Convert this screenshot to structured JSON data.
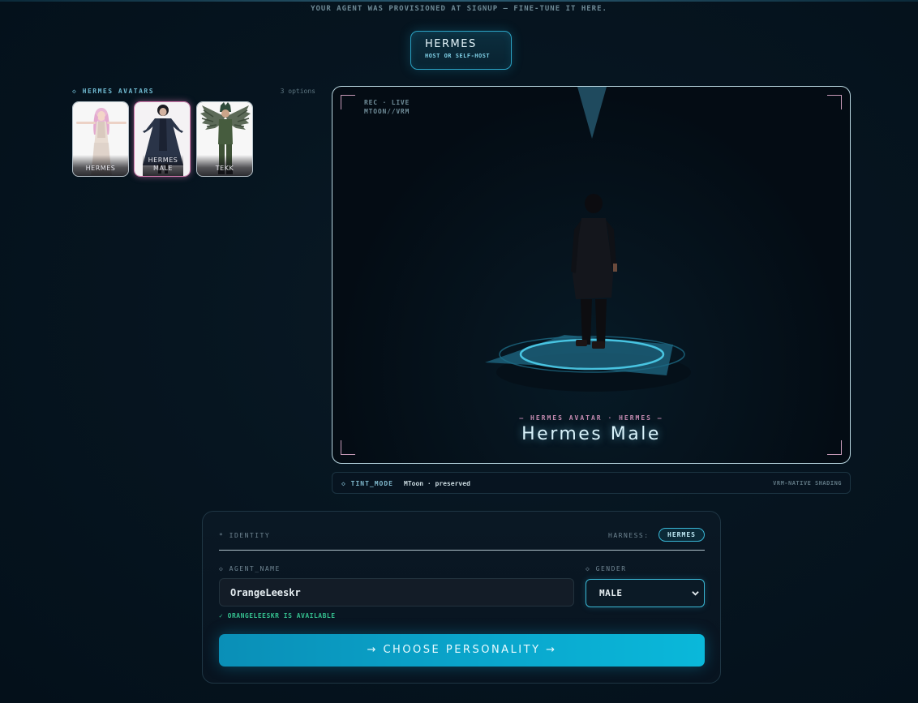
{
  "banner": "YOUR AGENT WAS PROVISIONED AT SIGNUP — FINE-TUNE IT HERE.",
  "harness": {
    "name": "HERMES",
    "sub": "HOST OR SELF-HOST"
  },
  "avatars": {
    "title": "◇ HERMES AVATARS",
    "count": "3 options",
    "items": [
      {
        "label": "HERMES",
        "selected": false
      },
      {
        "label": "HERMES MALE",
        "selected": true
      },
      {
        "label": "TEKK",
        "selected": false
      }
    ]
  },
  "viewport": {
    "rec": "REC · LIVE",
    "format": "MTOON//VRM",
    "subtitle": "— HERMES AVATAR · HERMES —",
    "title": "Hermes Male"
  },
  "tint": {
    "label": "◇ TINT_MODE",
    "value": "MToon · preserved",
    "right": "VRM-NATIVE SHADING"
  },
  "identity": {
    "section": "* IDENTITY",
    "harness_label": "HARNESS:",
    "harness_badge": "HERMES",
    "name_label": "◇ AGENT_NAME",
    "name_value": "OrangeLeeskr",
    "gender_label": "◇ GENDER",
    "gender_value": "MALE",
    "availability": "✓ ORANGELEESKR IS AVAILABLE",
    "cta": "→ CHOOSE PERSONALITY →"
  },
  "colors": {
    "accent": "#0aa6cc",
    "selected": "#d67bb0",
    "success": "#35c08f"
  }
}
